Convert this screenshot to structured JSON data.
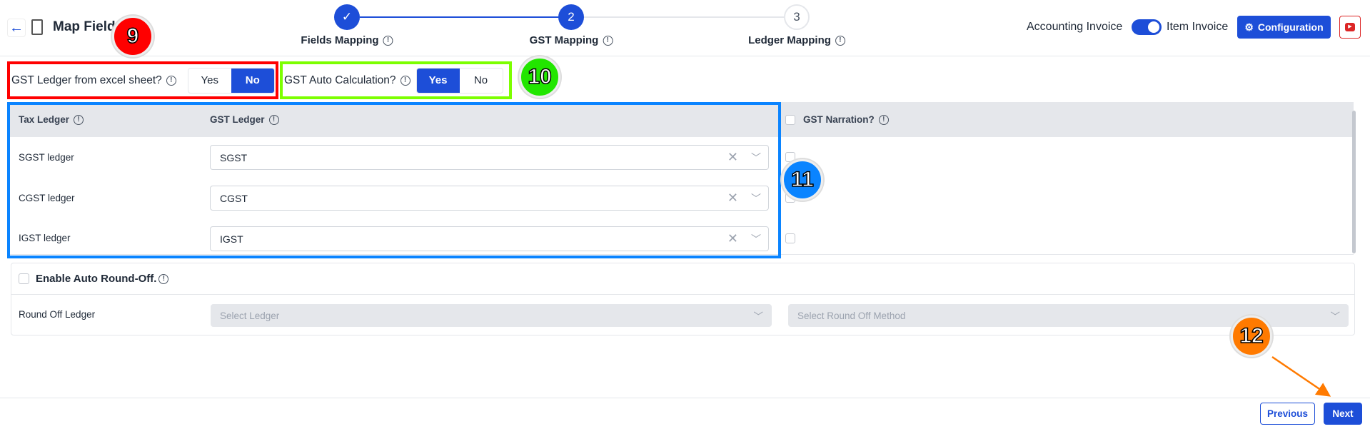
{
  "header": {
    "title": "Map Fields",
    "back_icon": "arrow-left-icon",
    "doc_icon": "document-icon"
  },
  "steps": [
    {
      "label": "Fields Mapping",
      "number": "✓",
      "state": "done"
    },
    {
      "label": "GST Mapping",
      "number": "2",
      "state": "active"
    },
    {
      "label": "Ledger Mapping",
      "number": "3",
      "state": "pending"
    }
  ],
  "invoice_toggle": {
    "left_label": "Accounting Invoice",
    "right_label": "Item Invoice",
    "state": "Item Invoice"
  },
  "configuration_label": "Configuration",
  "gst_ledger_excel": {
    "label": "GST Ledger from excel sheet?",
    "options": [
      "Yes",
      "No"
    ],
    "selected": "No"
  },
  "gst_auto_calc": {
    "label": "GST Auto Calculation?",
    "options": [
      "Yes",
      "No"
    ],
    "selected": "Yes"
  },
  "table": {
    "headers": {
      "tax_ledger": "Tax Ledger",
      "gst_ledger": "GST Ledger",
      "gst_narration": "GST Narration?"
    },
    "rows": [
      {
        "tax_ledger": "SGST ledger",
        "gst_ledger": "SGST"
      },
      {
        "tax_ledger": "CGST ledger",
        "gst_ledger": "CGST"
      },
      {
        "tax_ledger": "IGST ledger",
        "gst_ledger": "IGST"
      }
    ]
  },
  "round_off": {
    "enable_label": "Enable Auto Round-Off.",
    "ledger_label": "Round Off Ledger",
    "ledger_placeholder": "Select Ledger",
    "method_placeholder": "Select Round Off Method"
  },
  "footer": {
    "previous": "Previous",
    "next": "Next"
  },
  "annotations": [
    "9",
    "10",
    "11",
    "12"
  ],
  "colors": {
    "primary": "#1d4ed8",
    "badge9": "#ff0000",
    "badge10": "#22e600",
    "badge11": "#0a84ff",
    "badge12": "#ff7a00"
  }
}
